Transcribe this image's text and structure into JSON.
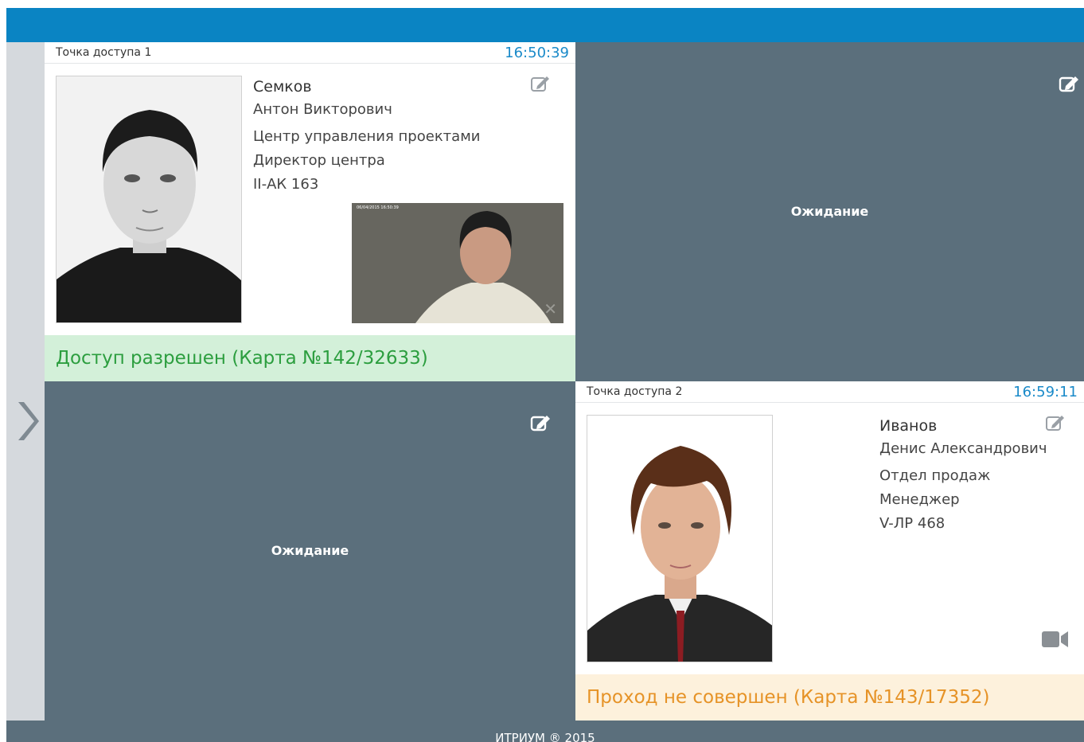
{
  "footer": {
    "text": "ИТРИУМ ® 2015"
  },
  "colors": {
    "header": "#0a84c3",
    "waiting_panel": "#5b6f7c",
    "sidebar": "#d5d9dd",
    "granted": "#2c9e3f",
    "denied": "#e69327",
    "time": "#1a8ac9"
  },
  "sidebar": {
    "toggle_icon": "chevron-right-icon"
  },
  "panels": [
    {
      "type": "event",
      "point": "Точка доступа 1",
      "time": "16:50:39",
      "person": {
        "last_name": "Семков",
        "first_middle": "Антон Викторович",
        "department": "Центр управления проектами",
        "position": "Директор центра",
        "id": "II-АК 163"
      },
      "snapshot": {
        "timestamp": "06/04/2015 16:50:39",
        "close_icon": "close-icon"
      },
      "edit_icon": "edit-icon",
      "status": "Доступ разрешен (Карта №142/32633)",
      "status_kind": "granted"
    },
    {
      "type": "waiting",
      "label": "Ожидание",
      "edit_icon": "edit-icon"
    },
    {
      "type": "waiting",
      "label": "Ожидание",
      "edit_icon": "edit-icon"
    },
    {
      "type": "event",
      "point": "Точка доступа 2",
      "time": "16:59:11",
      "person": {
        "last_name": "Иванов",
        "first_middle": "Денис Александрович",
        "department": "Отдел продаж",
        "position": "Менеджер",
        "id": "V-ЛР 468"
      },
      "camera_icon": "video-camera-icon",
      "edit_icon": "edit-icon",
      "status": "Проход не совершен (Карта №143/17352)",
      "status_kind": "denied"
    }
  ]
}
